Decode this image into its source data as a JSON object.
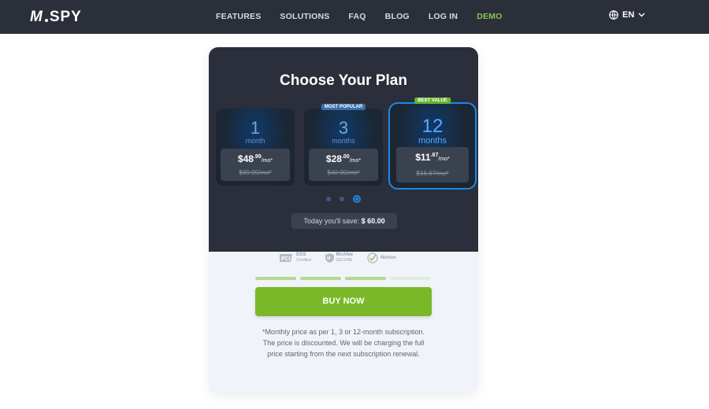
{
  "nav": {
    "logo": "SPY",
    "logo_mark": "M",
    "items": [
      {
        "label": "FEATURES"
      },
      {
        "label": "SOLUTIONS"
      },
      {
        "label": "FAQ"
      },
      {
        "label": "BLOG"
      },
      {
        "label": "LOG IN"
      },
      {
        "label": "DEMO"
      }
    ],
    "language": "EN"
  },
  "plan_card": {
    "title": "Choose Your Plan",
    "plans": [
      {
        "duration": "1",
        "unit": "month",
        "price_whole": "$48",
        "price_cents": ".99",
        "price_suffix": "/mo*",
        "old_price": "$69.99/mo*",
        "badge": ""
      },
      {
        "duration": "3",
        "unit": "months",
        "price_whole": "$28",
        "price_cents": ".00",
        "price_suffix": "/mo*",
        "old_price": "$40.00/mo*",
        "badge": "MOST POPULAR"
      },
      {
        "duration": "12",
        "unit": "months",
        "price_whole": "$11",
        "price_cents": ".67",
        "price_suffix": "/mo*",
        "old_price": "$16.67/mo*",
        "badge": "BEST VALUE"
      }
    ],
    "selected_plan_index": 2,
    "savings_label": "Today you'll save:",
    "savings_amount": "$ 60.00",
    "trust_badges": [
      {
        "text": "DSS",
        "subtext": "Certified"
      },
      {
        "text": "McAfee",
        "subtext": "SECURE"
      },
      {
        "text": "Norton",
        "subtext": ""
      }
    ],
    "progress_steps_total": 4,
    "progress_steps_completed": 3,
    "buy_button_label": "BUY NOW",
    "disclaimer": "*Monthly price as per 1, 3 or 12-month subscription. The price is discounted. We will be charging the full price starting from the next subscription renewal."
  },
  "colors": {
    "nav_bg": "#2b2f39",
    "accent_green": "#7ab829",
    "accent_blue": "#1e88e5",
    "demo_green": "#8bc34a"
  }
}
